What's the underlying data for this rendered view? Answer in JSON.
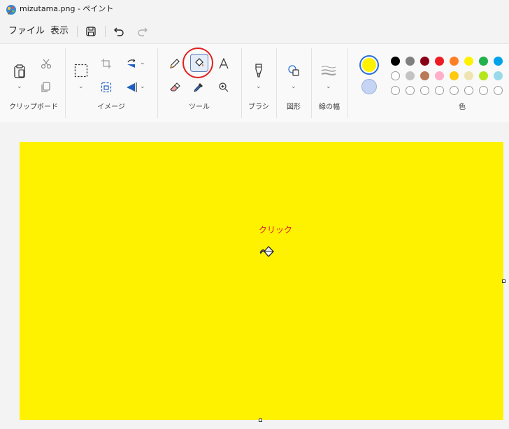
{
  "window": {
    "title": "mizutama.png - ペイント"
  },
  "menu": {
    "file": "ファイル",
    "view": "表示"
  },
  "ribbon": {
    "groups": {
      "clipboard": "クリップボード",
      "image": "イメージ",
      "tools": "ツール",
      "brush": "ブラシ",
      "shapes": "図形",
      "stroke_width": "線の幅",
      "colors": "色"
    },
    "primary_color": "#fff200",
    "secondary_color": "#c5d4f2",
    "palette_row1": [
      "#000000",
      "#7f7f7f",
      "#880015",
      "#ed1c24",
      "#ff7f27",
      "#fff200",
      "#22b14c",
      "#00a2e8"
    ],
    "palette_row2": [
      "#ffffff",
      "#c3c3c3",
      "#b97a57",
      "#ffaec9",
      "#ffc90e",
      "#efe4b0",
      "#b5e61d",
      "#99d9ea"
    ]
  },
  "canvas": {
    "fill_color": "#fff200",
    "annotation": "クリック",
    "highlight_color": "#e02020"
  }
}
